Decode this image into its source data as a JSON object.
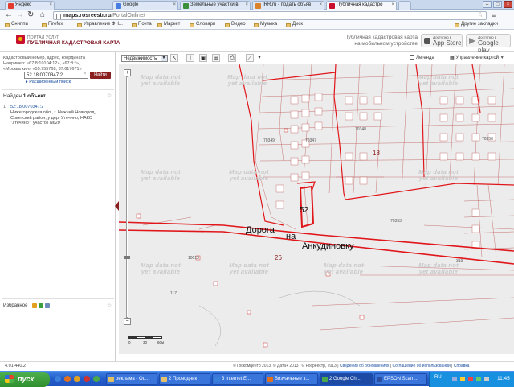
{
  "browser": {
    "tabs": [
      {
        "label": "Яндекс",
        "color": "#e33b2e"
      },
      {
        "label": "Google",
        "color": "#4a7de2"
      },
      {
        "label": "Земельные участки в",
        "color": "#3a8f3a"
      },
      {
        "label": "IRR.ru - подать объяв",
        "color": "#d9822b"
      },
      {
        "label": "Публичная кадастро",
        "color": "#c8102e"
      }
    ],
    "url_domain": "maps.rosreestr.ru",
    "url_path": "/PortalOnline/",
    "bookmarks": [
      "Сниппи",
      "Firefox",
      "Управление ФН...",
      "Почта",
      "Маркет",
      "Словари",
      "Видео",
      "Музыка",
      "Диск"
    ],
    "other_bookmarks": "Другие закладки"
  },
  "header": {
    "portal_label": "ПОРТАЛ УСЛУГ",
    "title": "ПУБЛИЧНАЯ КАДАСТРОВАЯ КАРТА",
    "mobile_text_1": "Публичная кадастровая карта",
    "mobile_text_2": "на мобильном устройстве",
    "appstore_small": "Доступно в",
    "appstore_big": "App Store",
    "googleplay_small": "Доступно в",
    "googleplay_big": "Google play"
  },
  "search": {
    "hint_1": "Кадастровый номер, адрес, координата",
    "hint_2": "Например: «67:8:10104:12», «67:8:*»,",
    "hint_3": "«Москва кин» «55.755768, 37.617671»",
    "value": "52 18:0070347:2",
    "button": "Найти",
    "advanced": "Расширенный поиск"
  },
  "results": {
    "found_prefix": "Найден",
    "found_count": "1 объект",
    "item_num": "1",
    "item_link": "52:18:0070347:2",
    "item_addr": "Нижегородская обл., г. Нижний Новгород, Советский район, у дер. Утечино, НАКО \"Утечино\", участок N620"
  },
  "favorites": {
    "label": "Избранное"
  },
  "map_toolbar": {
    "layer": "Недвижимость",
    "legend": "Легенда",
    "layer_control": "Управление картой"
  },
  "map": {
    "watermark": "Map data not yet available",
    "road_1": "Дорога",
    "road_2": "на",
    "road_3": "Анкудиновку",
    "parcel": "52",
    "num_18": "18",
    "num_26": "26",
    "labels": [
      "70349",
      "70347",
      "70348",
      "70350",
      "70353",
      "10013",
      "319",
      "117"
    ],
    "scale": [
      "0",
      "30",
      "60м"
    ]
  },
  "footer": {
    "version": "4.01.440.2",
    "copyright": "© Госкомцентр 2013, © Дата+ 2013 | © Росреестр, 2013 |",
    "links": [
      "Сведения об обновлениях",
      "Соглашение об использовании",
      "Справка"
    ]
  },
  "taskbar": {
    "start": "пуск",
    "tasks": [
      "реклама - Ou...",
      "2 Проводник",
      "3 Internet E...",
      "Визуальные з...",
      "2 Google Ch...",
      "EPSON Scan ..."
    ],
    "lang": "RU",
    "clock": "11:45"
  },
  "colors": {
    "brand": "#c8102e",
    "parcel_line": "#e0161a",
    "road": "#e0161a"
  }
}
